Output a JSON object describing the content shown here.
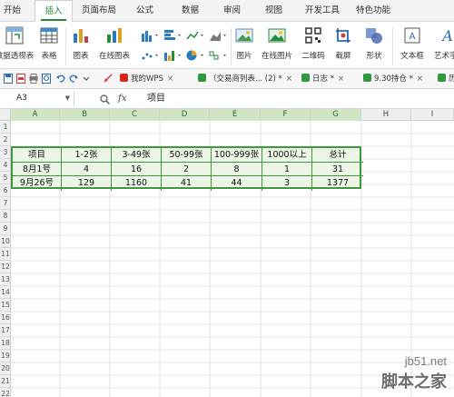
{
  "menu": {
    "items": [
      "开始",
      "插入",
      "页面布局",
      "公式",
      "数据",
      "审阅",
      "视图",
      "开发工具",
      "特色功能"
    ],
    "active_index": 1
  },
  "ribbon": {
    "tools": [
      {
        "label": "数据透视表",
        "icon": "pivot-table-icon"
      },
      {
        "label": "表格",
        "icon": "table-icon"
      },
      {
        "label": "图表",
        "icon": "chart-icon"
      },
      {
        "label": "在线图表",
        "icon": "online-chart-icon"
      },
      {
        "label": "图片",
        "icon": "picture-icon"
      },
      {
        "label": "在线图片",
        "icon": "online-picture-icon"
      },
      {
        "label": "二维码",
        "icon": "qr-code-icon"
      },
      {
        "label": "截屏",
        "icon": "screenshot-icon"
      },
      {
        "label": "形状",
        "icon": "shapes-icon"
      },
      {
        "label": "文本框",
        "icon": "textbox-icon"
      },
      {
        "label": "艺术字",
        "icon": "wordart-icon"
      }
    ]
  },
  "tabs": [
    {
      "label": "我的WPS",
      "color": "#d9261c"
    },
    {
      "label": "（交易商列表... (2) *",
      "color": "#2e9a3e"
    },
    {
      "label": "日志 *",
      "color": "#2e9a3e"
    },
    {
      "label": "9.30持仓 *",
      "color": "#2e9a3e"
    },
    {
      "label": "历",
      "color": "#2e9a3e"
    }
  ],
  "formula_bar": {
    "cell_ref": "A3",
    "fx": "fx",
    "value": "项目"
  },
  "grid": {
    "columns": [
      "A",
      "B",
      "C",
      "D",
      "E",
      "F",
      "G",
      "H",
      "I"
    ],
    "selected_columns": [
      "A",
      "B",
      "C",
      "D",
      "E",
      "F",
      "G"
    ],
    "row_numbers": [
      "1",
      "2",
      "3",
      "4",
      "5",
      "6",
      "7",
      "8",
      "9",
      "10",
      "11",
      "12",
      "13",
      "14",
      "15",
      "16",
      "17",
      "18",
      "19",
      "20",
      "21",
      "22"
    ]
  },
  "data_table": {
    "headers": [
      "项目",
      "1-2张",
      "3-49张",
      "50-99张",
      "100-999张",
      "1000以上",
      "总计"
    ],
    "rows": [
      [
        "8月1号",
        "4",
        "16",
        "2",
        "8",
        "1",
        "31"
      ],
      [
        "9月26号",
        "129",
        "1160",
        "41",
        "44",
        "3",
        "1377"
      ]
    ],
    "border_color": "#3f9a3f",
    "fill_color": "#edf5e7"
  },
  "watermark": {
    "site": "jb51.net",
    "name": "脚本之家"
  },
  "colors": {
    "accent": "#2a8a3c",
    "selection": "#cfe5c4"
  }
}
